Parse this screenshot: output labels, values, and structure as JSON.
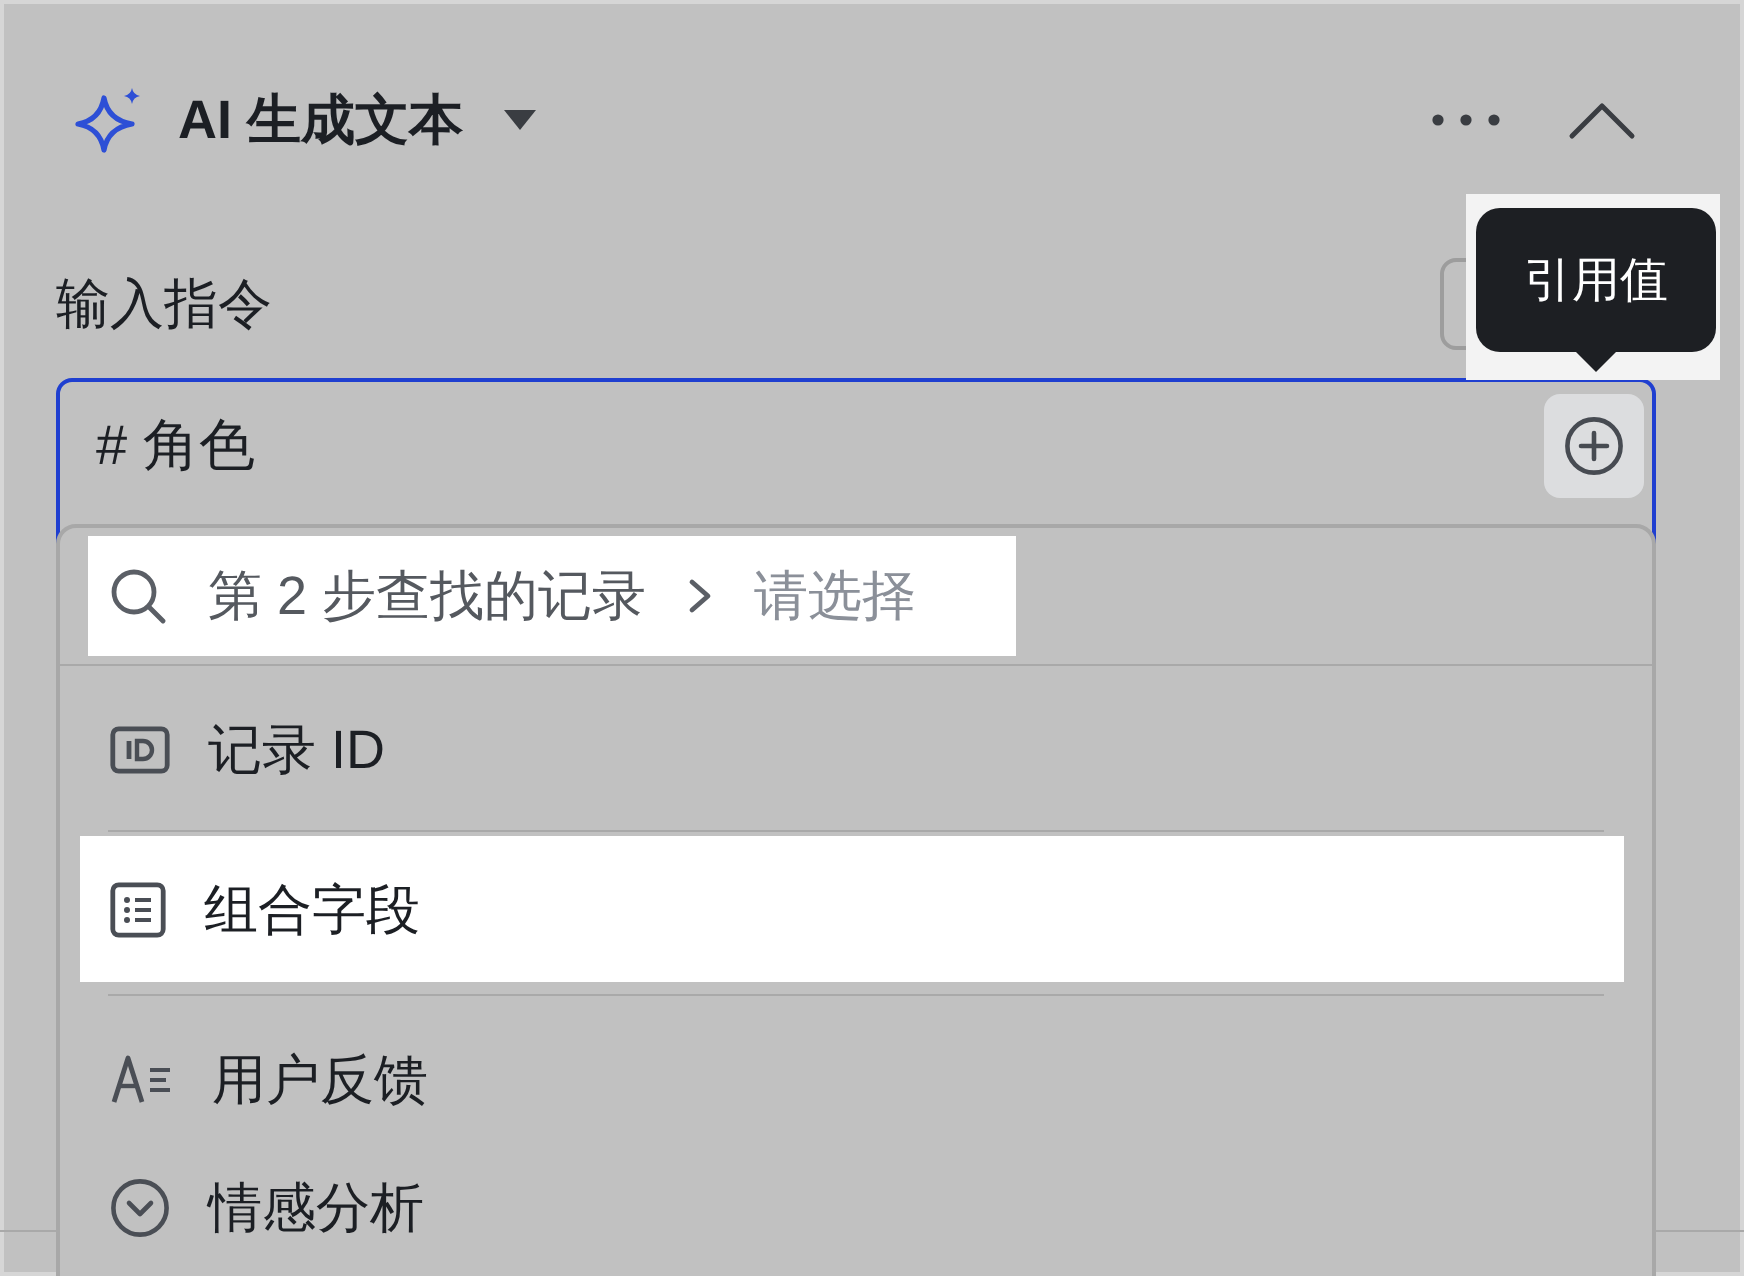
{
  "panel": {
    "title": "AI 生成文本",
    "expanded": true
  },
  "instruction": {
    "label": "输入指令",
    "value": "# 角色"
  },
  "tooltip": {
    "text": "引用值"
  },
  "dropdown": {
    "search": {
      "source": "第 2 步查找的记录",
      "placeholder": "请选择"
    },
    "groups": [
      {
        "items": [
          {
            "kind": "id",
            "label": "记录 ID",
            "selected": false
          }
        ]
      },
      {
        "items": [
          {
            "kind": "list",
            "label": "组合字段",
            "selected": true
          }
        ]
      },
      {
        "items": [
          {
            "kind": "text",
            "label": "用户反馈",
            "selected": false
          },
          {
            "kind": "option",
            "label": "情感分析",
            "selected": false
          }
        ]
      }
    ]
  }
}
